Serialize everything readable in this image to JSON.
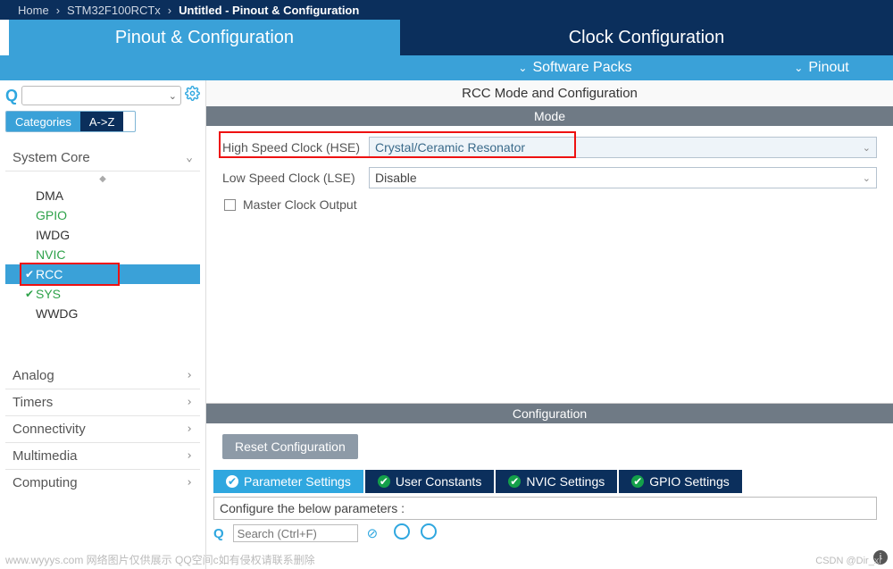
{
  "breadcrumb": {
    "home": "Home",
    "device": "STM32F100RCTx",
    "page": "Untitled - Pinout & Configuration"
  },
  "tabs": {
    "pinout": "Pinout & Configuration",
    "clock": "Clock Configuration"
  },
  "subtabs": {
    "software": "Software Packs",
    "pinout": "Pinout"
  },
  "left": {
    "search_icon": "Q",
    "categories_tab": "Categories",
    "az_tab": "A->Z",
    "sections": {
      "system": "System Core",
      "analog": "Analog",
      "timers": "Timers",
      "connectivity": "Connectivity",
      "multimedia": "Multimedia",
      "computing": "Computing"
    },
    "items": {
      "dma": "DMA",
      "gpio": "GPIO",
      "iwdg": "IWDG",
      "nvic": "NVIC",
      "rcc": "RCC",
      "sys": "SYS",
      "wwdg": "WWDG"
    }
  },
  "right": {
    "title": "RCC Mode and Configuration",
    "mode_header": "Mode",
    "hse_label": "High Speed Clock (HSE)",
    "hse_value": "Crystal/Ceramic Resonator",
    "lse_label": "Low Speed Clock (LSE)",
    "lse_value": "Disable",
    "mco_label": "Master Clock Output",
    "config_header": "Configuration",
    "reset_btn": "Reset Configuration",
    "ctabs": {
      "param": "Parameter Settings",
      "user": "User Constants",
      "nvic": "NVIC Settings",
      "gpio": "GPIO Settings"
    },
    "params_hint": "Configure the below parameters :",
    "filter_placeholder": "Search (Ctrl+F)"
  },
  "watermark": "www.wyyys.com 网络图片仅供展示 QQ空间c如有侵权请联系删除",
  "watermark2": "CSDN @Dir_xr"
}
